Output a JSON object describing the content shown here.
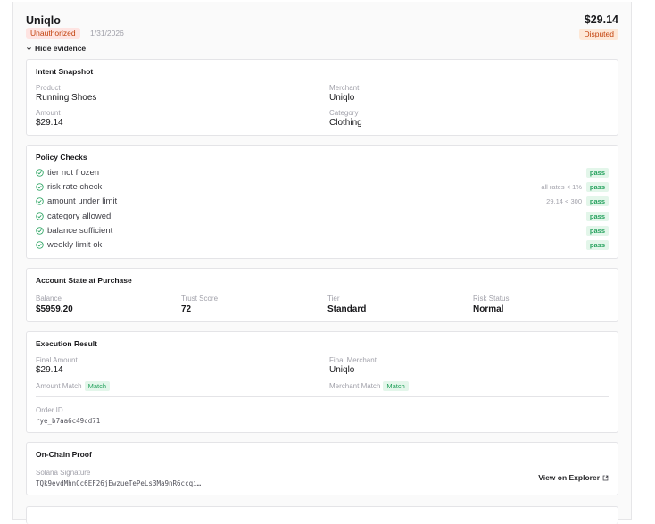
{
  "transaction": {
    "merchant": "Uniqlo",
    "status": "Unauthorized",
    "date": "1/31/2026",
    "amount": "$29.14",
    "dispute_status": "Disputed",
    "toggle_label": "Hide evidence"
  },
  "intent": {
    "title": "Intent Snapshot",
    "product_label": "Product",
    "product": "Running Shoes",
    "merchant_label": "Merchant",
    "merchant": "Uniqlo",
    "amount_label": "Amount",
    "amount": "$29.14",
    "category_label": "Category",
    "category": "Clothing"
  },
  "policy": {
    "title": "Policy Checks",
    "checks": [
      {
        "name": "tier not frozen",
        "note": "",
        "result": "pass"
      },
      {
        "name": "risk rate check",
        "note": "all rates < 1%",
        "result": "pass"
      },
      {
        "name": "amount under limit",
        "note": "29.14 < 300",
        "result": "pass"
      },
      {
        "name": "category allowed",
        "note": "",
        "result": "pass"
      },
      {
        "name": "balance sufficient",
        "note": "",
        "result": "pass"
      },
      {
        "name": "weekly limit ok",
        "note": "",
        "result": "pass"
      }
    ]
  },
  "account": {
    "title": "Account State at Purchase",
    "balance_label": "Balance",
    "balance": "$5959.20",
    "trust_label": "Trust Score",
    "trust": "72",
    "tier_label": "Tier",
    "tier": "Standard",
    "risk_label": "Risk Status",
    "risk": "Normal"
  },
  "execution": {
    "title": "Execution Result",
    "final_amount_label": "Final Amount",
    "final_amount": "$29.14",
    "final_merchant_label": "Final Merchant",
    "final_merchant": "Uniqlo",
    "amount_match_label": "Amount Match",
    "amount_match": "Match",
    "merchant_match_label": "Merchant Match",
    "merchant_match": "Match",
    "order_label": "Order ID",
    "order_id": "rye_b7aa6c49cd71"
  },
  "proof": {
    "title": "On-Chain Proof",
    "signature_label": "Solana Signature",
    "signature": "TQk9evdMhnCc6EF26jEwzueTePeLs3Ma9nR6ccqi…",
    "explorer_label": "View on Explorer"
  },
  "colors": {
    "pass_green": "#22a05b",
    "pass_bg": "#e3f6ea",
    "warning_orange": "#c2410c",
    "warning_bg": "#fee4e2"
  }
}
